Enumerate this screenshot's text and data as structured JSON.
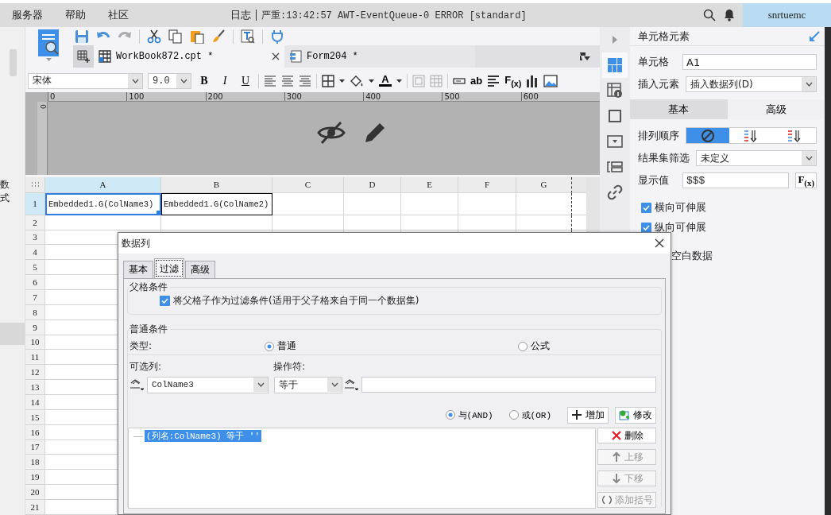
{
  "menu": [
    "服务器",
    "帮助",
    "社区"
  ],
  "log": {
    "label": "日志",
    "message": "严重:13:42:57 AWT-EventQueue-0 ERROR [standard]"
  },
  "user": "snrtuemc",
  "left_strip": [
    "数",
    "式"
  ],
  "file_tabs": [
    {
      "label": "WorkBook872.cpt *",
      "kind": "workbook",
      "selected": true
    },
    {
      "label": "Form204 *",
      "kind": "form",
      "selected": false
    }
  ],
  "format_bar": {
    "font": "宋体",
    "size": "9.0",
    "style_buttons": [
      "B",
      "I",
      "U"
    ],
    "font_color": "A",
    "text_tools": [
      "ab",
      "F$_{(x)}$"
    ]
  },
  "ruler": {
    "ticks": [
      "0",
      "100",
      "200",
      "300",
      "400",
      "500",
      "600"
    ],
    "vertical": "0"
  },
  "sheet": {
    "columns": [
      {
        "label": "A",
        "selected": true
      },
      {
        "label": "B",
        "selected": false
      },
      {
        "label": "C",
        "selected": false
      },
      {
        "label": "D",
        "selected": false
      },
      {
        "label": "E",
        "selected": false
      },
      {
        "label": "F",
        "selected": false
      },
      {
        "label": "G",
        "selected": false
      }
    ],
    "rows": [
      {
        "label": "1",
        "selected": true,
        "cells": [
          {
            "text": "Embedded1.G(ColName3)",
            "selected": true
          },
          {
            "text": "Embedded1.G(ColName2)",
            "selected": false
          }
        ]
      },
      {
        "label": "2",
        "selected": false
      },
      {
        "label": "3",
        "selected": false
      },
      {
        "label": "4",
        "selected": false
      },
      {
        "label": "5",
        "selected": false
      },
      {
        "label": "6",
        "selected": false
      },
      {
        "label": "7",
        "selected": false
      },
      {
        "label": "8",
        "selected": false
      },
      {
        "label": "9",
        "selected": false
      },
      {
        "label": "10",
        "selected": false
      },
      {
        "label": "11",
        "selected": false
      },
      {
        "label": "12",
        "selected": false
      },
      {
        "label": "13",
        "selected": false
      },
      {
        "label": "14",
        "selected": false
      },
      {
        "label": "15",
        "selected": false
      },
      {
        "label": "16",
        "selected": false
      },
      {
        "label": "17",
        "selected": false
      },
      {
        "label": "18",
        "selected": false
      },
      {
        "label": "19",
        "selected": false
      },
      {
        "label": "20",
        "selected": false
      },
      {
        "label": "21",
        "selected": false
      }
    ]
  },
  "cell_panel": {
    "title": "单元格元素",
    "cell_label": "单元格",
    "cell_value": "A1",
    "insert_label": "插入元素",
    "insert_value": "插入数据列(D)",
    "tabs": [
      {
        "label": "基本",
        "selected": true
      },
      {
        "label": "高级",
        "selected": false
      }
    ],
    "sort_label": "排列顺序",
    "sort_options": [
      {
        "kind": "none",
        "selected": true
      },
      {
        "kind": "asc",
        "selected": false
      },
      {
        "kind": "desc",
        "selected": false
      }
    ],
    "filter_label": "结果集筛选",
    "filter_value": "未定义",
    "display_label": "显示值",
    "display_value": "$$$",
    "formula_button": "F$_{(x)}$",
    "checks": [
      {
        "label": "横向可伸展",
        "checked": true
      },
      {
        "label": "纵向可伸展",
        "checked": true
      }
    ],
    "partial_text": "空白数据"
  },
  "dialog": {
    "title": "数据列",
    "tabs": [
      {
        "label": "基本",
        "selected": false
      },
      {
        "label": "过滤",
        "selected": true
      },
      {
        "label": "高级",
        "selected": false
      }
    ],
    "parent_group": {
      "title": "父格条件",
      "checkbox": {
        "label": "将父格子作为过滤条件(适用于父子格来自于同一个数据集)",
        "checked": true
      }
    },
    "common_group": {
      "title": "普通条件",
      "type_label": "类型:",
      "types": [
        {
          "label": "普通",
          "selected": true
        },
        {
          "label": "公式",
          "selected": false
        }
      ],
      "column_label": "可选列:",
      "column_value": "ColName3",
      "operator_label": "操作符:",
      "operator_value": "等于",
      "logic": [
        {
          "label": "与(AND)",
          "selected": true
        },
        {
          "label": "或(OR)",
          "selected": false
        }
      ],
      "buttons": [
        {
          "label": "增加",
          "kind": "add"
        },
        {
          "label": "修改",
          "kind": "edit"
        }
      ],
      "conditions": [
        {
          "text": "(列名:ColName3) 等于 ''",
          "selected": true
        }
      ],
      "side_buttons": [
        {
          "label": "删除",
          "kind": "delete",
          "disabled": false
        },
        {
          "label": "上移",
          "kind": "up",
          "disabled": true
        },
        {
          "label": "下移",
          "kind": "down",
          "disabled": true
        },
        {
          "label": "添加括号",
          "kind": "paren",
          "disabled": true
        }
      ]
    }
  }
}
